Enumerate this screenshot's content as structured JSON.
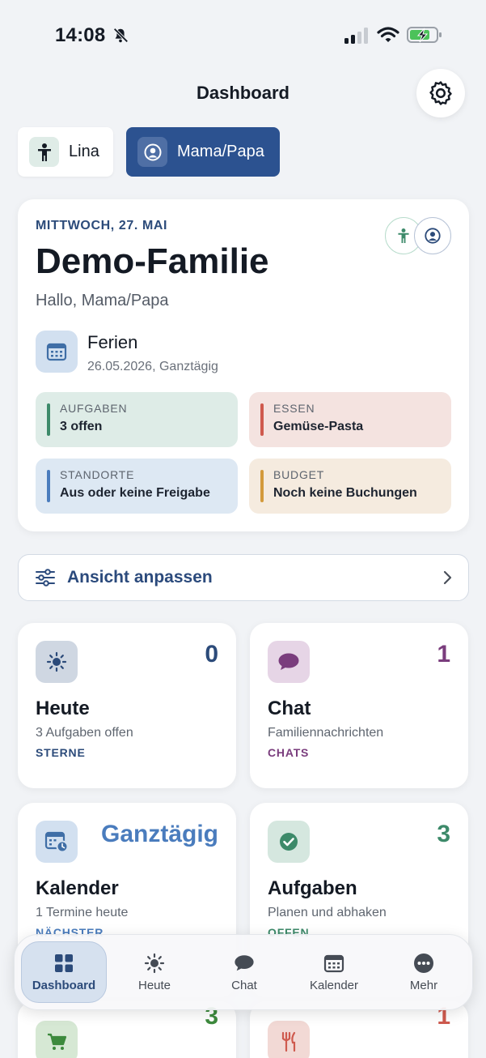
{
  "status_bar": {
    "time": "14:08",
    "mute_icon": "bell-slash-icon",
    "signal_icon": "signal-icon",
    "wifi_icon": "wifi-icon",
    "battery_icon": "battery-charging-icon"
  },
  "header": {
    "title": "Dashboard",
    "settings_icon": "gear-icon"
  },
  "profiles": [
    {
      "label": "Lina",
      "icon": "child-figure-icon",
      "active": false
    },
    {
      "label": "Mama/Papa",
      "icon": "person-circle-icon",
      "active": true
    }
  ],
  "summary": {
    "date": "MITTWOCH, 27. MAI",
    "family": "Demo-Familie",
    "greeting": "Hallo, Mama/Papa",
    "event": {
      "title": "Ferien",
      "sub": "26.05.2026, Ganztägig",
      "icon": "calendar-icon"
    },
    "tiles": {
      "tasks": {
        "label": "AUFGABEN",
        "value": "3 offen",
        "color": "#3d8a6a"
      },
      "food": {
        "label": "ESSEN",
        "value": "Gemüse-Pasta",
        "color": "#cf5a4e"
      },
      "locations": {
        "label": "STANDORTE",
        "value": "Aus oder keine Freigabe",
        "color": "#4a7cbd"
      },
      "budget": {
        "label": "BUDGET",
        "value": "Noch keine Buchungen",
        "color": "#d39a3c"
      }
    }
  },
  "customize": {
    "label": "Ansicht anpassen",
    "icon": "sliders-icon"
  },
  "widgets": {
    "heute": {
      "count": "0",
      "title": "Heute",
      "sub": "3 Aufgaben offen",
      "tag": "STERNE",
      "accent": "#2c4b7a"
    },
    "chat": {
      "count": "1",
      "title": "Chat",
      "sub": "Familiennachrichten",
      "tag": "CHATS",
      "accent": "#7a3d7d"
    },
    "kalender": {
      "count": "Ganztägig",
      "title": "Kalender",
      "sub": "1 Termine heute",
      "tag": "NÄCHSTER",
      "accent": "#4a7cbd"
    },
    "aufgaben": {
      "count": "3",
      "title": "Aufgaben",
      "sub": "Planen und abhaken",
      "tag": "OFFEN",
      "accent": "#3d8a6a"
    },
    "einkauf": {
      "count": "3",
      "accent": "#3d8a3d"
    },
    "essen": {
      "count": "1",
      "accent": "#cf5a4e"
    }
  },
  "tabbar": [
    {
      "label": "Dashboard",
      "icon": "grid-icon",
      "active": true
    },
    {
      "label": "Heute",
      "icon": "sun-icon",
      "active": false
    },
    {
      "label": "Chat",
      "icon": "chat-bubble-icon",
      "active": false
    },
    {
      "label": "Kalender",
      "icon": "calendar-icon",
      "active": false
    },
    {
      "label": "Mehr",
      "icon": "more-dots-icon",
      "active": false
    }
  ]
}
